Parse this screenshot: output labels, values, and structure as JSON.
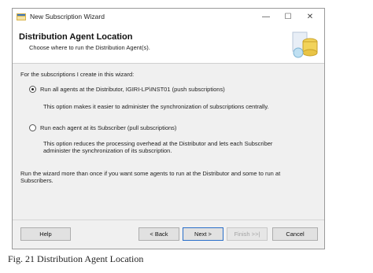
{
  "window": {
    "title": "New Subscription Wizard",
    "controls": {
      "minimize": "—",
      "maximize": "☐",
      "close": "✕"
    }
  },
  "header": {
    "title": "Distribution Agent Location",
    "subtitle": "Choose where to run the Distribution Agent(s)."
  },
  "content": {
    "prompt": "For the subscriptions I create in this wizard:",
    "options": [
      {
        "label": "Run all agents at the Distributor, IGIRI-LP\\INST01 (push subscriptions)",
        "selected": true,
        "description": "This option makes it easier to administer the synchronization of subscriptions centrally."
      },
      {
        "label": "Run each agent at its Subscriber (pull subscriptions)",
        "selected": false,
        "description": "This option reduces the processing overhead at the Distributor and lets each Subscriber administer the synchronization of its subscription."
      }
    ],
    "note": "Run the wizard more than once if you want some agents to run at the Distributor and some to run at Subscribers."
  },
  "buttons": {
    "help": "Help",
    "back": "< Back",
    "next": "Next >",
    "finish": "Finish >>|",
    "cancel": "Cancel"
  },
  "caption": "Fig. 21 Distribution Agent Location"
}
